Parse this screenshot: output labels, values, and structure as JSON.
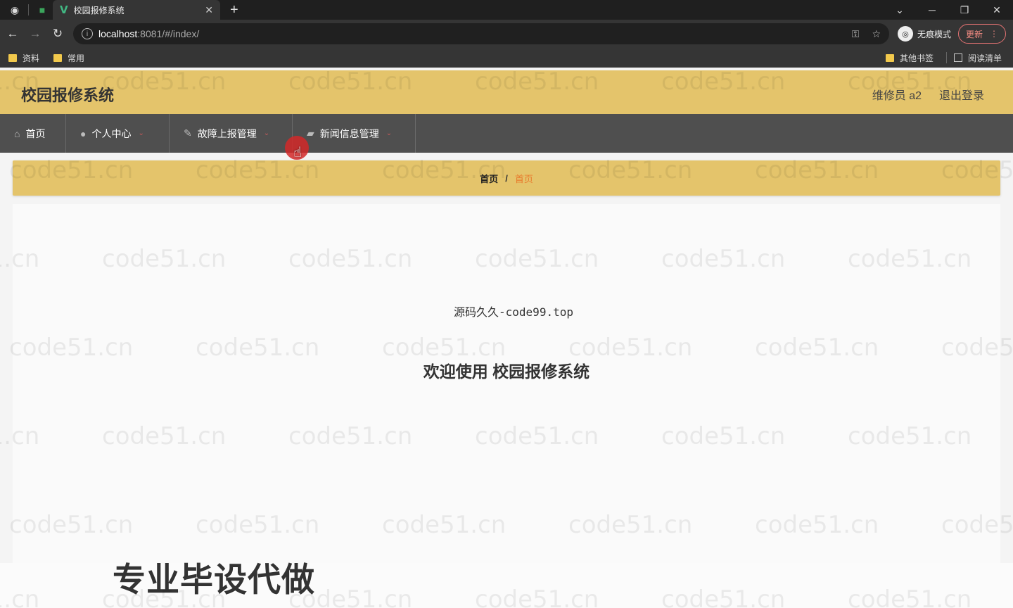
{
  "browser": {
    "tab_title": "校园报修系统",
    "new_tab_icon": "+",
    "url_host": "localhost",
    "url_path": ":8081/#/index/",
    "incognito_label": "无痕模式",
    "update_label": "更新",
    "bookmarks": [
      "资料",
      "常用"
    ],
    "other_bookmarks": "其他书签",
    "reading_list": "阅读清单"
  },
  "app": {
    "brand": "校园报修系统",
    "user": "维修员 a2",
    "logout": "退出登录"
  },
  "menu": [
    {
      "label": "首页",
      "icon": "home-icon"
    },
    {
      "label": "个人中心",
      "icon": "user-icon"
    },
    {
      "label": "故障上报管理",
      "icon": "edit-icon"
    },
    {
      "label": "新闻信息管理",
      "icon": "news-icon"
    }
  ],
  "breadcrumb": {
    "root": "首页",
    "separator": "/",
    "current": "首页"
  },
  "main": {
    "notice": "源码久久-code99.top",
    "welcome": "欢迎使用 校园报修系统"
  },
  "overlay": {
    "promo": "专业毕设代做",
    "watermark": "code51.cn"
  },
  "colors": {
    "header": "#e4c46b",
    "menubar": "#4f4f4f",
    "crumb_current": "#e87a2c"
  }
}
